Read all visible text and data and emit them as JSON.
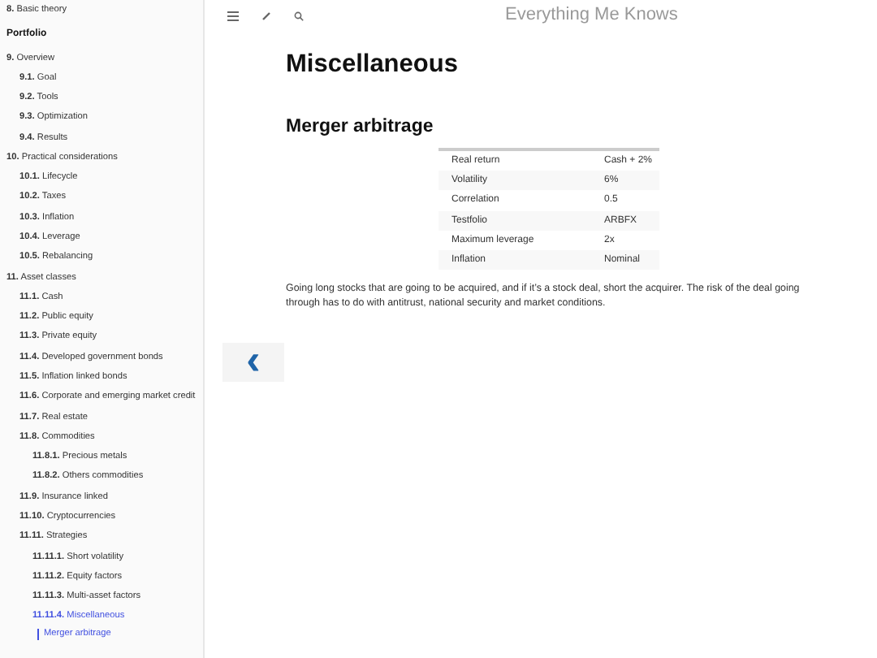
{
  "sidebar": {
    "items": [
      {
        "kind": "chapter",
        "number": "8.",
        "title": "Basic theory",
        "selected": false
      },
      {
        "kind": "header",
        "title": "Portfolio"
      },
      {
        "kind": "chapter",
        "number": "9.",
        "title": "Overview",
        "selected": false,
        "children": [
          {
            "kind": "chapter",
            "number": "9.1.",
            "title": "Goal",
            "selected": false
          },
          {
            "kind": "chapter",
            "number": "9.2.",
            "title": "Tools",
            "selected": false
          },
          {
            "kind": "chapter",
            "number": "9.3.",
            "title": "Optimization",
            "selected": false
          },
          {
            "kind": "chapter",
            "number": "9.4.",
            "title": "Results",
            "selected": false
          }
        ]
      },
      {
        "kind": "chapter",
        "number": "10.",
        "title": "Practical considerations",
        "selected": false,
        "children": [
          {
            "kind": "chapter",
            "number": "10.1.",
            "title": "Lifecycle",
            "selected": false
          },
          {
            "kind": "chapter",
            "number": "10.2.",
            "title": "Taxes",
            "selected": false
          },
          {
            "kind": "chapter",
            "number": "10.3.",
            "title": "Inflation",
            "selected": false
          },
          {
            "kind": "chapter",
            "number": "10.4.",
            "title": "Leverage",
            "selected": false
          },
          {
            "kind": "chapter",
            "number": "10.5.",
            "title": "Rebalancing",
            "selected": false
          }
        ]
      },
      {
        "kind": "chapter",
        "number": "11.",
        "title": "Asset classes",
        "selected": false,
        "children": [
          {
            "kind": "chapter",
            "number": "11.1.",
            "title": "Cash",
            "selected": false
          },
          {
            "kind": "chapter",
            "number": "11.2.",
            "title": "Public equity",
            "selected": false
          },
          {
            "kind": "chapter",
            "number": "11.3.",
            "title": "Private equity",
            "selected": false
          },
          {
            "kind": "chapter",
            "number": "11.4.",
            "title": "Developed government bonds",
            "selected": false
          },
          {
            "kind": "chapter",
            "number": "11.5.",
            "title": "Inflation linked bonds",
            "selected": false
          },
          {
            "kind": "chapter",
            "number": "11.6.",
            "title": "Corporate and emerging market credit",
            "selected": false
          },
          {
            "kind": "chapter",
            "number": "11.7.",
            "title": "Real estate",
            "selected": false
          },
          {
            "kind": "chapter",
            "number": "11.8.",
            "title": "Commodities",
            "selected": false,
            "children": [
              {
                "kind": "chapter",
                "number": "11.8.1.",
                "title": "Precious metals",
                "selected": false
              },
              {
                "kind": "chapter",
                "number": "11.8.2.",
                "title": "Others commodities",
                "selected": false
              }
            ]
          },
          {
            "kind": "chapter",
            "number": "11.9.",
            "title": "Insurance linked",
            "selected": false
          },
          {
            "kind": "chapter",
            "number": "11.10.",
            "title": "Cryptocurrencies",
            "selected": false
          },
          {
            "kind": "chapter",
            "number": "11.11.",
            "title": "Strategies",
            "selected": false,
            "children": [
              {
                "kind": "chapter",
                "number": "11.11.1.",
                "title": "Short volatility",
                "selected": false
              },
              {
                "kind": "chapter",
                "number": "11.11.2.",
                "title": "Equity factors",
                "selected": false
              },
              {
                "kind": "chapter",
                "number": "11.11.3.",
                "title": "Multi-asset factors",
                "selected": false
              },
              {
                "kind": "chapter",
                "number": "11.11.4.",
                "title": "Miscellaneous",
                "selected": true,
                "children": [
                  {
                    "kind": "anchor",
                    "title": "Merger arbitrage",
                    "selected": true
                  }
                ]
              }
            ]
          }
        ]
      }
    ]
  },
  "header": {
    "title": "Everything Me Knows"
  },
  "page": {
    "title": "Miscellaneous",
    "sections": [
      {
        "heading": "Merger arbitrage",
        "table": [
          [
            "Real return",
            "Cash + 2%"
          ],
          [
            "Volatility",
            "6%"
          ],
          [
            "Correlation",
            "0.5"
          ],
          [
            "Testfolio",
            "ARBFX"
          ],
          [
            "Maximum leverage",
            "2x"
          ],
          [
            "Inflation",
            "Nominal"
          ]
        ],
        "text": "Going long stocks that are going to be acquired, and if it’s a stock deal, short the acquirer. The risk of the deal going through has to do with antitrust, national security and market conditions."
      }
    ]
  },
  "navigation": {
    "previous": "‹"
  }
}
